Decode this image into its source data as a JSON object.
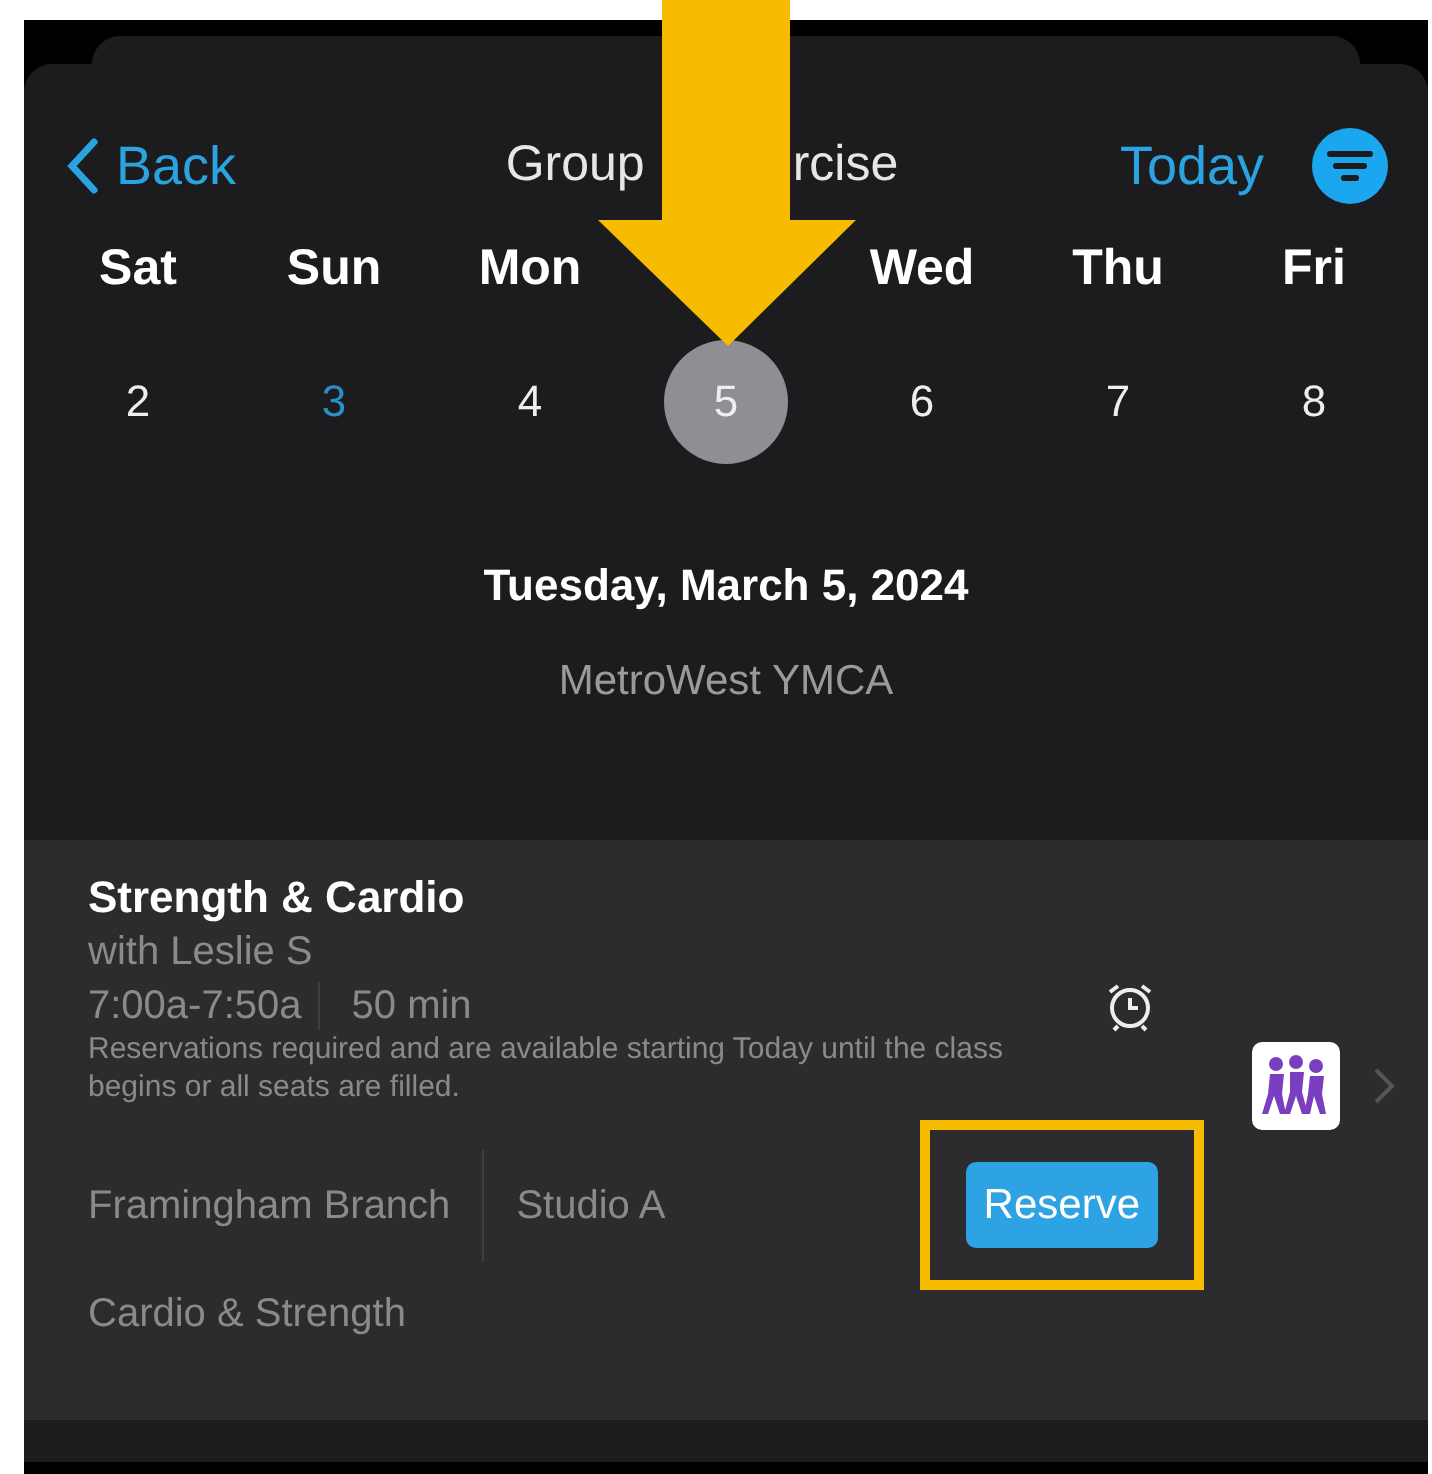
{
  "header": {
    "back": "Back",
    "title_parts": [
      "Group",
      "rcise"
    ],
    "today": "Today"
  },
  "days": [
    {
      "name": "Sat",
      "date": "2",
      "selected": false,
      "highlighted": false
    },
    {
      "name": "Sun",
      "date": "3",
      "selected": false,
      "highlighted": true
    },
    {
      "name": "Mon",
      "date": "4",
      "selected": false,
      "highlighted": false
    },
    {
      "date": "5",
      "selected": true,
      "highlighted": false
    },
    {
      "name": "Wed",
      "date": "6",
      "selected": false,
      "highlighted": false
    },
    {
      "name": "Thu",
      "date": "7",
      "selected": false,
      "highlighted": false
    },
    {
      "name": "Fri",
      "date": "8",
      "selected": false,
      "highlighted": false
    }
  ],
  "date_heading": "Tuesday, March 5, 2024",
  "location": "MetroWest YMCA",
  "class": {
    "title": "Strength & Cardio",
    "instructor": "with Leslie S",
    "time": "7:00a-7:50a",
    "duration": "50 min",
    "note": "Reservations required and are available starting Today until the class begins or all seats are filled.",
    "branch": "Framingham Branch",
    "studio": "Studio A",
    "button": "Reserve",
    "category": "Cardio & Strength"
  },
  "callouts": {
    "arrow_over_date": true,
    "box_around_reserve": true
  }
}
